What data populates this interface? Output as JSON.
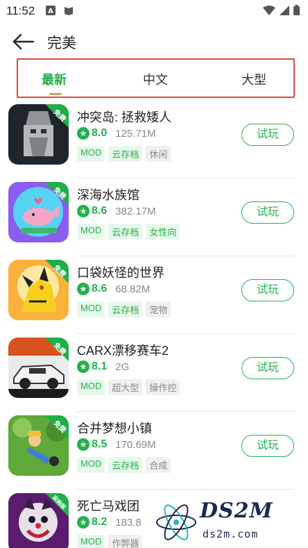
{
  "status": {
    "time": "11:52"
  },
  "header": {
    "title": "完美"
  },
  "tabs": [
    {
      "label": "最新",
      "active": true
    },
    {
      "label": "中文",
      "active": false
    },
    {
      "label": "大型",
      "active": false
    }
  ],
  "apps": [
    {
      "name": "冲突岛: 拯救矮人",
      "rating": "8.0",
      "size": "125.71M",
      "badge": "免费",
      "action": "试玩",
      "tags": [
        {
          "text": "MOD",
          "style": "green"
        },
        {
          "text": "云存档",
          "style": "green"
        },
        {
          "text": "休闲",
          "style": "gray"
        }
      ]
    },
    {
      "name": "深海水族馆",
      "rating": "8.6",
      "size": "382.17M",
      "badge": "免费",
      "action": "试玩",
      "tags": [
        {
          "text": "MOD",
          "style": "green"
        },
        {
          "text": "云存档",
          "style": "green"
        },
        {
          "text": "女性向",
          "style": "green"
        }
      ]
    },
    {
      "name": "口袋妖怪的世界",
      "rating": "8.6",
      "size": "68.82M",
      "badge": "免费",
      "action": "试玩",
      "tags": [
        {
          "text": "MOD",
          "style": "green"
        },
        {
          "text": "云存档",
          "style": "green"
        },
        {
          "text": "宠物",
          "style": "gray"
        }
      ]
    },
    {
      "name": "CARX漂移赛车2",
      "rating": "8.1",
      "size": "2G",
      "badge": "免费",
      "action": "试玩",
      "tags": [
        {
          "text": "MOD",
          "style": "green"
        },
        {
          "text": "超大型",
          "style": "gray"
        },
        {
          "text": "操作控",
          "style": "gray"
        }
      ]
    },
    {
      "name": "合并梦想小镇",
      "rating": "8.5",
      "size": "170.69M",
      "badge": "免费",
      "action": "试玩",
      "tags": [
        {
          "text": "MOD",
          "style": "green"
        },
        {
          "text": "云存档",
          "style": "green"
        },
        {
          "text": "合成",
          "style": "gray"
        }
      ]
    },
    {
      "name": "死亡马戏团",
      "rating": "8.2",
      "size": "183.8",
      "badge": "采购版",
      "action": "",
      "tags": [
        {
          "text": "MOD",
          "style": "green"
        },
        {
          "text": "作弊器",
          "style": "gray"
        }
      ]
    }
  ],
  "watermark": {
    "text": "DS2M",
    "sub": "ds2m.com"
  },
  "colors": {
    "accent": "#22b14c",
    "highlight_border": "#e0443a"
  }
}
